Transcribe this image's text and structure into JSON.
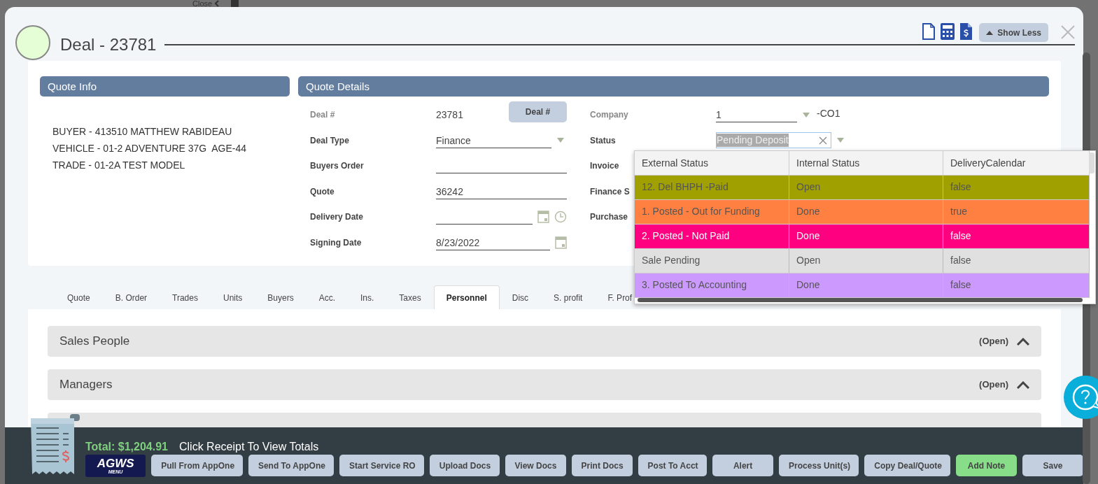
{
  "background": {
    "close_link": "Close"
  },
  "modal": {
    "title": "Deal - 23781",
    "show_less_button": "Show Less"
  },
  "quote_info": {
    "title": "Quote Info",
    "lines": [
      "BUYER - 413510 MATTHEW RABIDEAU",
      "VEHICLE - 01-2 ADVENTURE 37G  AGE-44",
      "TRADE - 01-2A TEST MODEL"
    ]
  },
  "quote_details": {
    "title": "Quote Details",
    "left_fields": [
      {
        "kind": "static",
        "label": "Deal #",
        "value": "23781",
        "button": "Deal #",
        "disabled": true
      },
      {
        "kind": "select",
        "label": "Deal Type",
        "value": "Finance",
        "disabled": false
      },
      {
        "kind": "input",
        "label": "Buyers Order",
        "disabled": false
      },
      {
        "kind": "input",
        "label": "Quote",
        "value": "36242",
        "disabled": false
      },
      {
        "kind": "datetime",
        "label": "Delivery Date",
        "disabled": false
      },
      {
        "kind": "date",
        "label": "Signing Date",
        "value": "8/23/2022",
        "disabled": false
      }
    ],
    "right_fields": [
      {
        "kind": "select",
        "label": "Company",
        "value": "1",
        "suffix": "-CO1",
        "disabled": true
      },
      {
        "kind": "combo",
        "label": "Status",
        "value": "Pending Deposit",
        "disabled": false
      },
      {
        "kind": "label",
        "label": "Invoice",
        "disabled": false
      },
      {
        "kind": "label",
        "label": "Finance S",
        "disabled": false
      },
      {
        "kind": "label",
        "label": "Purchase",
        "disabled": false
      }
    ]
  },
  "tabs": [
    {
      "label": "Quote",
      "selected": false
    },
    {
      "label": "B. Order",
      "selected": false
    },
    {
      "label": "Trades",
      "selected": false
    },
    {
      "label": "Units",
      "selected": false
    },
    {
      "label": "Buyers",
      "selected": false
    },
    {
      "label": "Acc.",
      "selected": false
    },
    {
      "label": "Ins.",
      "selected": false
    },
    {
      "label": "Taxes",
      "selected": false
    },
    {
      "label": "Personnel",
      "selected": true
    },
    {
      "label": "Disc",
      "selected": false
    },
    {
      "label": "S. profit",
      "selected": false
    },
    {
      "label": "F. Prof",
      "selected": false
    }
  ],
  "sections": [
    {
      "kind": "header",
      "title": "Sales People",
      "status": "(Open)",
      "expanded": true
    },
    {
      "kind": "header",
      "title": "Managers",
      "status": "(Open)",
      "expanded": true
    },
    {
      "kind": "partial"
    }
  ],
  "status_dropdown": {
    "columns": [
      "External Status",
      "Internal Status",
      "DeliveryCalendar"
    ],
    "rows": [
      {
        "cells": [
          "12. Del BHPH -Paid",
          "Open",
          "false"
        ],
        "color": "#a0a000"
      },
      {
        "cells": [
          "1. Posted - Out for Funding",
          "Done",
          "true"
        ],
        "color": "#ff8040"
      },
      {
        "cells": [
          "2. Posted - Not Paid",
          "Done",
          "false"
        ],
        "color": "#ff0080"
      },
      {
        "cells": [
          "Sale Pending",
          "Open",
          "false"
        ],
        "color": "#e0e0e0"
      },
      {
        "cells": [
          "3. Posted To Accounting",
          "Done",
          "false"
        ],
        "color": "#cc99ff"
      }
    ]
  },
  "footer": {
    "total": "Total: $1,204.91",
    "hint": "Click Receipt To View Totals",
    "logo": {
      "title": "AGWS",
      "subtitle": "MENU"
    },
    "buttons": [
      {
        "label": "Pull From AppOne",
        "kind": "default"
      },
      {
        "label": "Send To AppOne",
        "kind": "default"
      },
      {
        "label": "Start Service RO",
        "kind": "default"
      },
      {
        "label": "Upload Docs",
        "kind": "default"
      },
      {
        "label": "View Docs",
        "kind": "default"
      },
      {
        "label": "Print Docs",
        "kind": "default"
      },
      {
        "label": "Post To Acct",
        "kind": "default"
      },
      {
        "label": "Alert",
        "kind": "default"
      },
      {
        "label": "Process Unit(s)",
        "kind": "default"
      },
      {
        "label": "Copy Deal/Quote",
        "kind": "default"
      },
      {
        "label": "Add Note",
        "kind": "success"
      },
      {
        "label": "Save",
        "kind": "default"
      }
    ]
  }
}
